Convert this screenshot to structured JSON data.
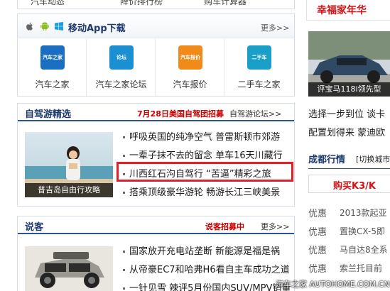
{
  "top_strip": {
    "items": [
      "汽车动态",
      "降价排行榜",
      "购车计算器"
    ]
  },
  "app_download": {
    "title": "移动App下载",
    "more": "更多>>",
    "os_icons": [
      "apple-icon",
      "android-icon",
      "windows-icon"
    ],
    "apps": [
      {
        "label": "汽车之家",
        "icon_text": "汽车之家",
        "color": "#1b6fc2"
      },
      {
        "label": "汽车之家论坛",
        "icon_text": "论坛",
        "color": "#1b8fd2"
      },
      {
        "label": "汽车报价",
        "icon_text": "汽车报价",
        "color": "#f08a18"
      },
      {
        "label": "二手车之家",
        "icon_text": "二手车",
        "color": "#1aa0c8"
      }
    ]
  },
  "travel": {
    "title": "自驾游精选",
    "promo": "7月28日美国自驾团招募",
    "link": "自驾游论坛>>",
    "photo_caption": "普吉岛自由行攻略",
    "news": [
      "呼吸英国的纯净空气 普雷斯顿市郊游",
      "一辈子抹不去的留念 单车16天川藏行",
      "川西红石沟自驾行 “苦逼”精彩之旅",
      "搭乘顶级豪华游轮 畅游长江三峡美景"
    ]
  },
  "talk": {
    "title": "说客",
    "promo": "说客招募中",
    "more": "更多>>",
    "news": [
      "国家放开充电站垄断 新能源是福是祸",
      "从帝豪EC7和哈弗H6看自主车成功之道",
      "一针见雪 辣评5月份国内SUV/MPV销量"
    ]
  },
  "right_column": {
    "banner": "幸福家年华",
    "photo_caption": "评宝马118i领先型",
    "lines": [
      "选择一步到位 谈卡",
      "配置划得来 蒙迪欧"
    ],
    "city_label": "成都行情",
    "city_switch": "[切换城市",
    "buy_button": "购买K3/K",
    "deals": [
      {
        "tag": "优惠",
        "text": "2013款起亚"
      },
      {
        "tag": "优惠",
        "text": "置换CX-5即"
      },
      {
        "tag": "优惠",
        "text": "马自达8全系"
      },
      {
        "tag": "优惠",
        "text": "索兰托目前"
      }
    ]
  },
  "watermark": "汽车之家 AUTOHOME.COM.CN"
}
